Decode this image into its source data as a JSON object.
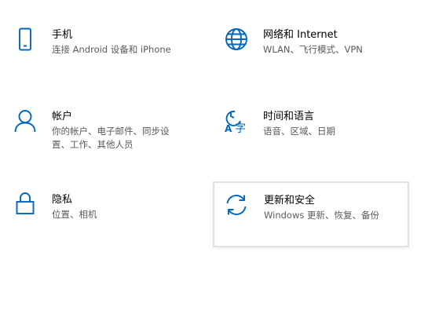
{
  "accent_color": "#0067c0",
  "tiles": [
    {
      "icon": "phone-icon",
      "title": "手机",
      "desc_lines": [
        "连接 Android 设备和 iPhone"
      ]
    },
    {
      "icon": "globe-icon",
      "title": "网络和 Internet",
      "desc_lines": [
        "WLAN、飞行模式、VPN"
      ]
    },
    {
      "icon": "person-icon",
      "title": "帐户",
      "desc_lines": [
        "你的帐户、电子邮件、同步设",
        "置、工作、其他人员"
      ]
    },
    {
      "icon": "language-icon",
      "title": "时间和语言",
      "desc_lines": [
        "语音、区域、日期"
      ]
    },
    {
      "icon": "lock-icon",
      "title": "隐私",
      "desc_lines": [
        "位置、相机"
      ]
    },
    {
      "icon": "refresh-icon",
      "title": "更新和安全",
      "desc_lines": [
        "Windows 更新、恢复、备份"
      ]
    }
  ]
}
